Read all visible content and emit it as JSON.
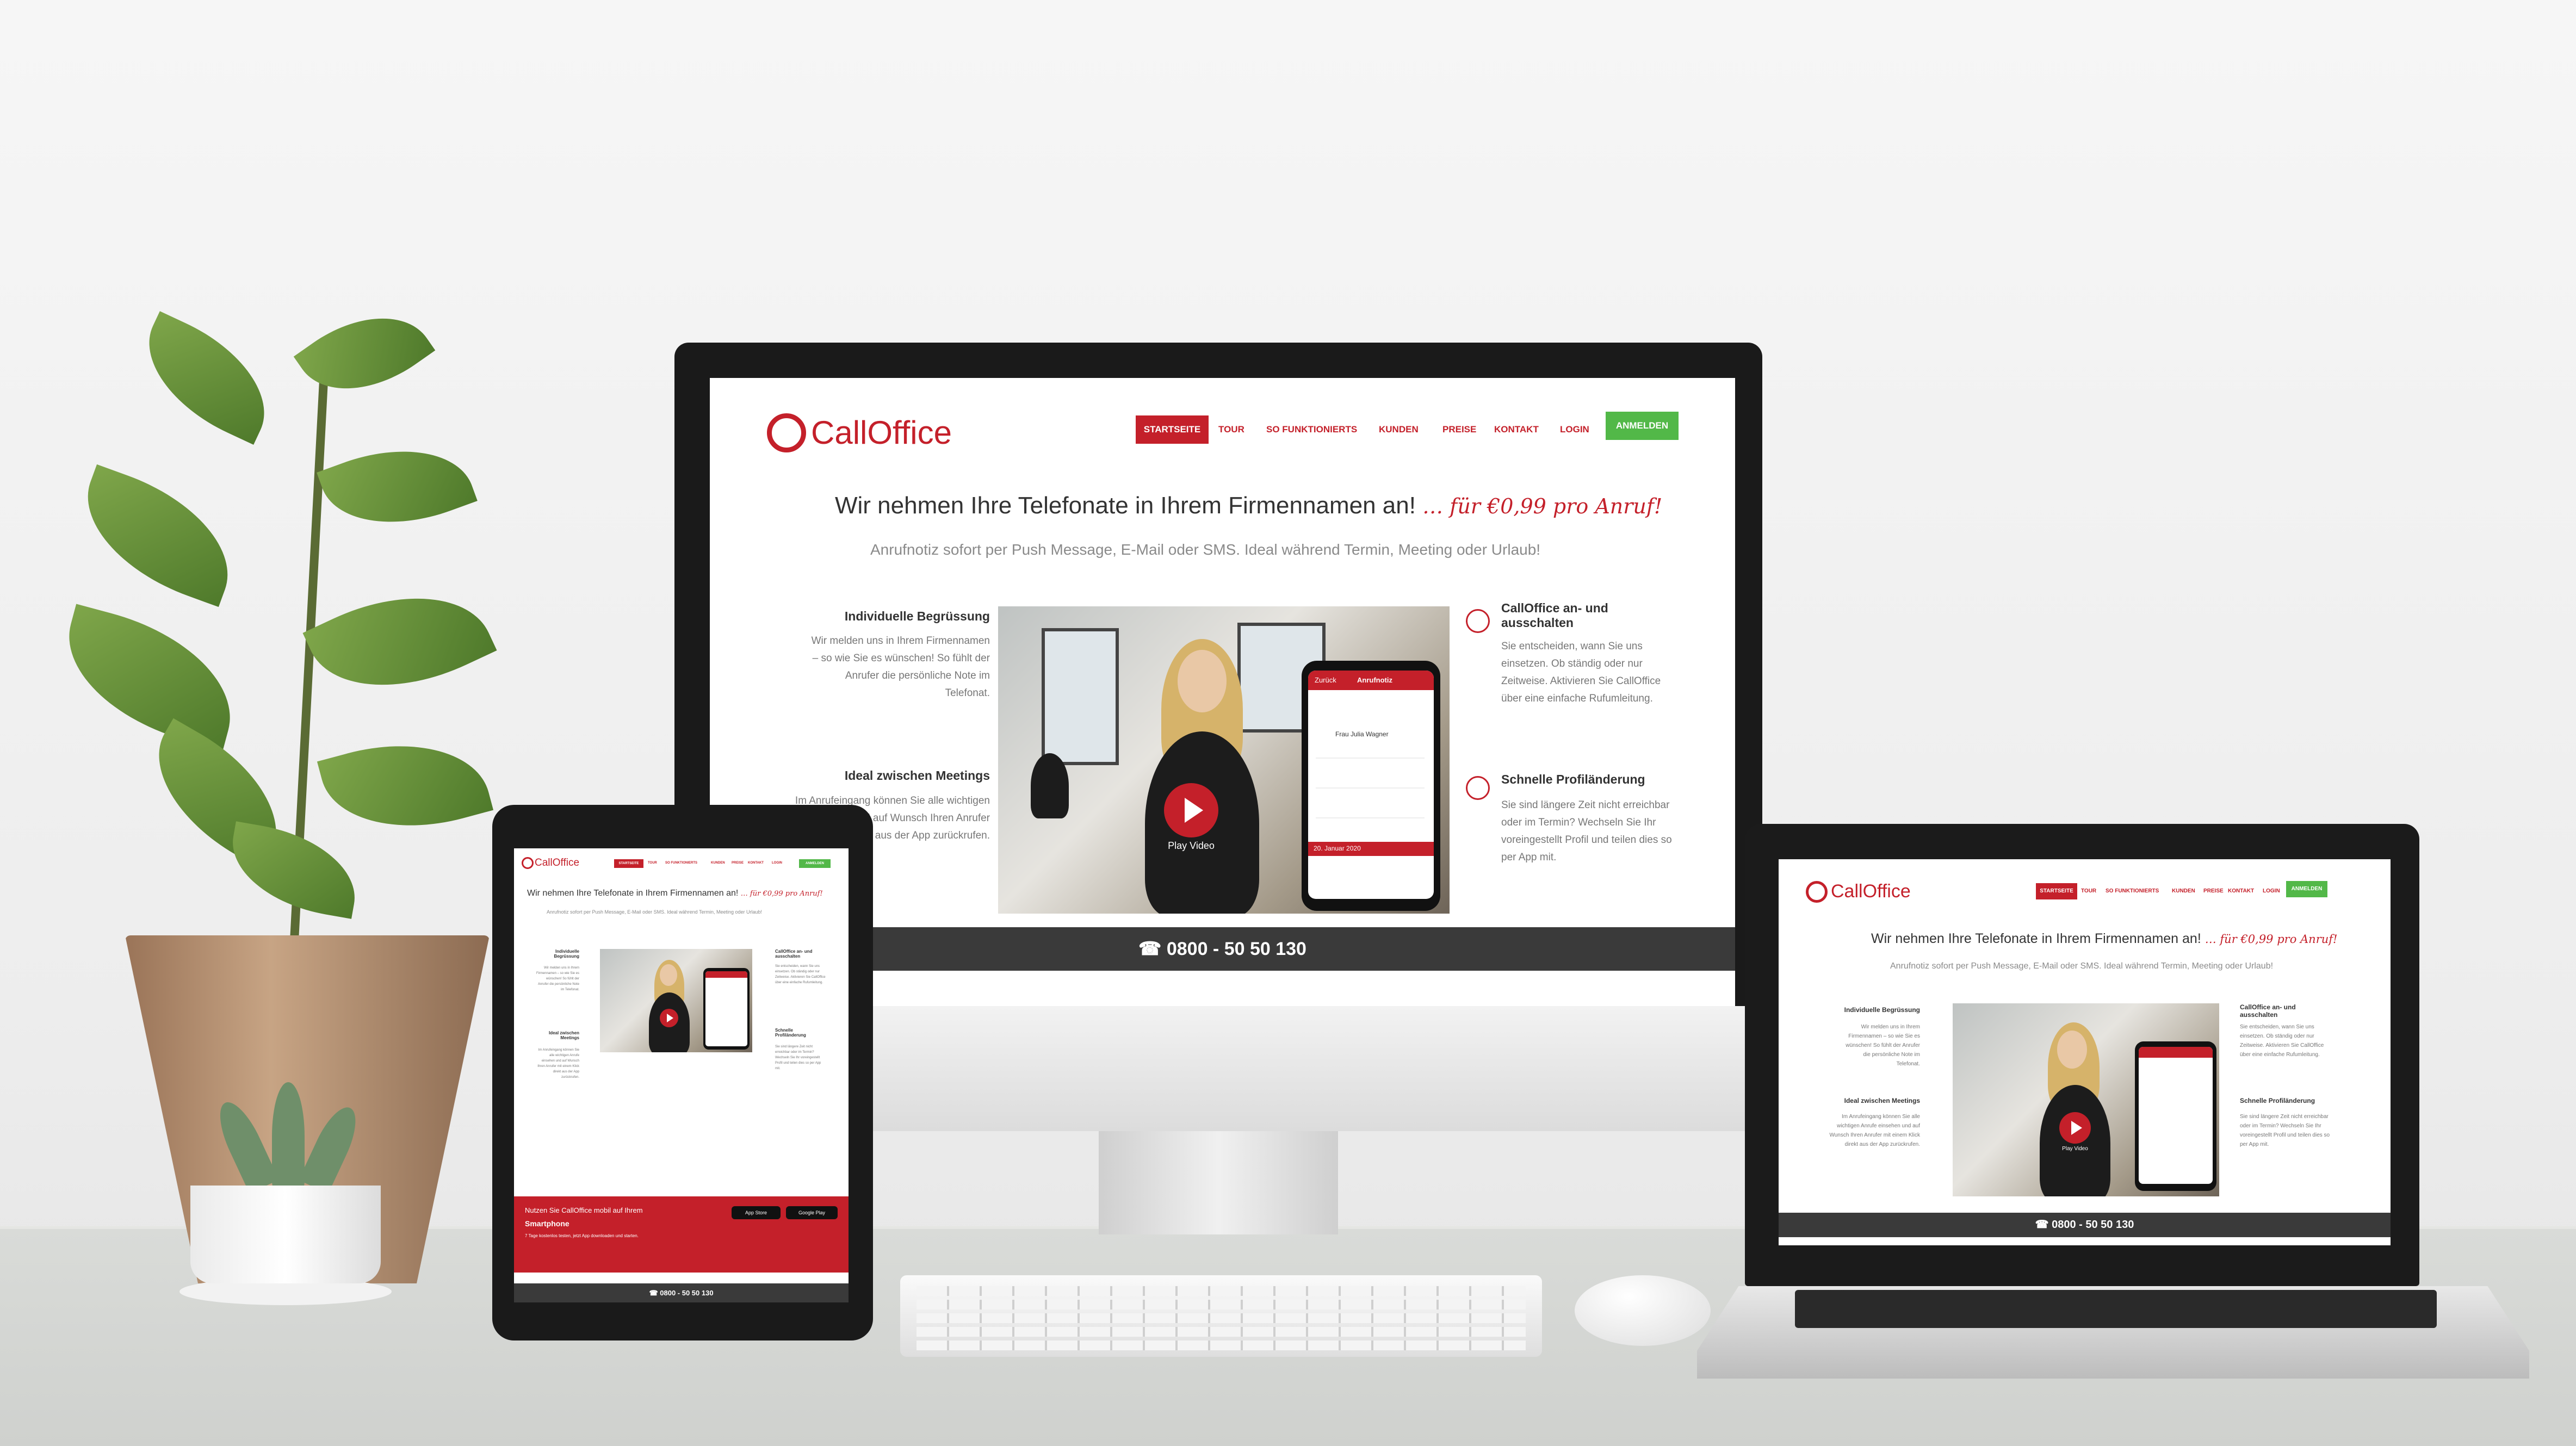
{
  "brand": {
    "name": "CallOffice",
    "accent": "#c4202a",
    "success": "#52b848"
  },
  "nav": {
    "items": [
      "STARTSEITE",
      "TOUR",
      "SO FUNKTIONIERTS",
      "KUNDEN",
      "PREISE",
      "KONTAKT",
      "LOGIN"
    ],
    "signup": "ANMELDEN"
  },
  "hero": {
    "headline": "Wir nehmen Ihre Telefonate in Ihrem Firmennamen an!",
    "promo": "… für €0,99 pro Anruf!",
    "subline": "Anrufnotiz sofort per Push Message, E-Mail oder SMS. Ideal während Termin, Meeting oder Urlaub!"
  },
  "features": {
    "left": [
      {
        "title": "Individuelle Begrüssung",
        "text": "Wir melden uns in Ihrem Firmennamen – so wie Sie es wünschen! So fühlt der Anrufer die persönliche Note im Telefonat.",
        "icon": "chat-bubble-icon"
      },
      {
        "title": "Ideal zwischen Meetings",
        "text": "Im Anrufeingang können Sie alle wichtigen Anrufe einsehen und auf Wunsch Ihren Anrufer mit einem Klick direkt aus der App zurückrufen.",
        "icon": "chat-bubbles-icon"
      }
    ],
    "right": [
      {
        "title": "CallOffice an- und ausschalten",
        "text": "Sie entscheiden, wann Sie uns einsetzen. Ob ständig oder nur Zeitweise. Aktivieren Sie CallOffice über eine einfache Rufumleitung.",
        "icon": "toggle-icon"
      },
      {
        "title": "Schnelle Profiländerung",
        "text": "Sie sind längere Zeit nicht erreichbar oder im Termin? Wechseln Sie Ihr voreingestellt Profil und teilen dies so per App mit.",
        "icon": "refresh-icon"
      }
    ]
  },
  "video": {
    "play_label": "Play Video",
    "phone_header": "Anrufnotiz",
    "phone_back": "Zurück",
    "caller": "Frau Julia Wagner",
    "phone_footer": "20. Januar 2020"
  },
  "footer": {
    "phone": "0800 - 50 50 130"
  },
  "tablet_banner": {
    "line1": "Nutzen Sie CallOffice mobil auf Ihrem",
    "line2": "Smartphone",
    "line3": "7 Tage kostenlos testen, jetzt App downloaden und starten.",
    "app_store": "App Store",
    "google_play": "Google Play"
  }
}
